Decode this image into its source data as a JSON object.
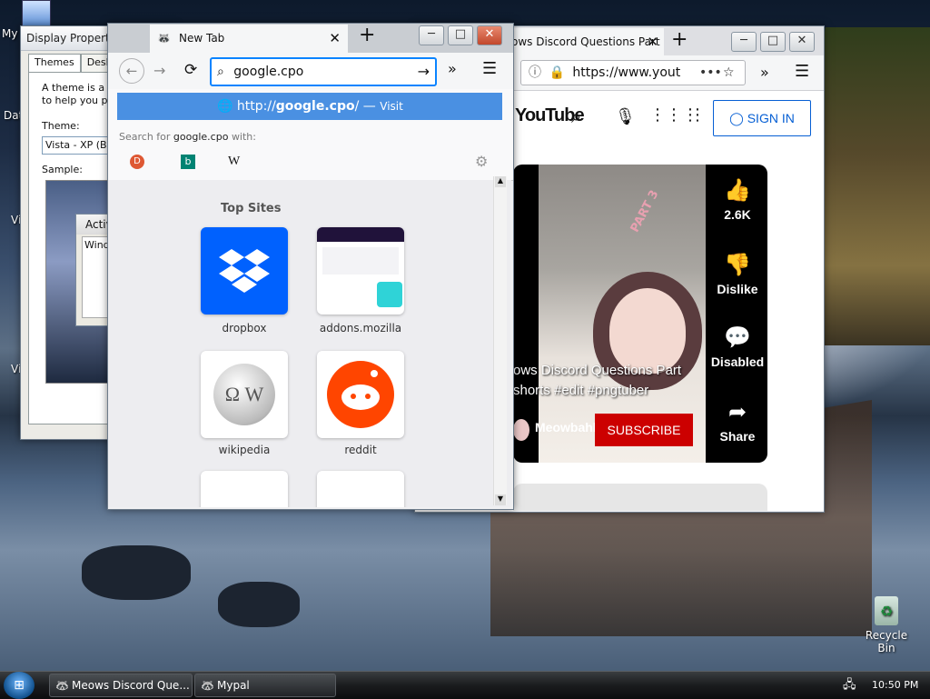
{
  "desktop": {
    "icons": [
      {
        "id": "my",
        "label": "My"
      },
      {
        "id": "dat",
        "label": "Dat"
      },
      {
        "id": "mvi1",
        "label": "M\nVi"
      },
      {
        "id": "mvi2",
        "label": "M\nVi"
      }
    ],
    "recycle_bin_label": "Recycle Bin"
  },
  "display_properties": {
    "title": "Display Properties",
    "tabs": [
      "Themes",
      "Deskto"
    ],
    "desc_line1": "A theme is a ba",
    "desc_line2": "to help you per",
    "theme_label": "Theme:",
    "theme_value": "Vista - XP (Bet",
    "sample_label": "Sample:",
    "sample_window_title": "Activ",
    "sample_window_text": "Windo"
  },
  "youtube_window": {
    "tab_title": "ows Discord Questions Part",
    "url": "https://www.yout",
    "logo": "YouTube",
    "sign_in": "SIGN IN",
    "video_title_line1": "ows Discord Questions Part",
    "video_title_line2": "shorts #edit #pngtuber",
    "video_overlay_text": "PART 3",
    "channel": "Meowbahh",
    "subscribe": "SUBSCRIBE",
    "likes": "2.6K",
    "dislike": "Dislike",
    "comments": "Disabled",
    "share": "Share"
  },
  "firefox_window": {
    "tab_title": "New Tab",
    "url_value": "google.cpo",
    "suggestion_prefix": "http://",
    "suggestion_bold": "google.cpo",
    "suggestion_suffix": "/ —",
    "suggestion_action": "Visit",
    "search_for_prefix": "Search for",
    "search_for_term": "google.cpo",
    "search_for_suffix": "with:",
    "top_sites_heading": "Top Sites",
    "top_sites": [
      {
        "label": "dropbox"
      },
      {
        "label": "addons.mozilla"
      },
      {
        "label": "wikipedia"
      },
      {
        "label": "reddit"
      }
    ]
  },
  "taskbar": {
    "buttons": [
      {
        "label": "Meows Discord Que..."
      },
      {
        "label": "Mypal"
      }
    ],
    "clock": "10:50 PM"
  },
  "colors": {
    "firefox_accent": "#0a84ff",
    "youtube_red": "#cc0000",
    "dropbox_blue": "#0061fe",
    "reddit_orange": "#ff4500"
  }
}
